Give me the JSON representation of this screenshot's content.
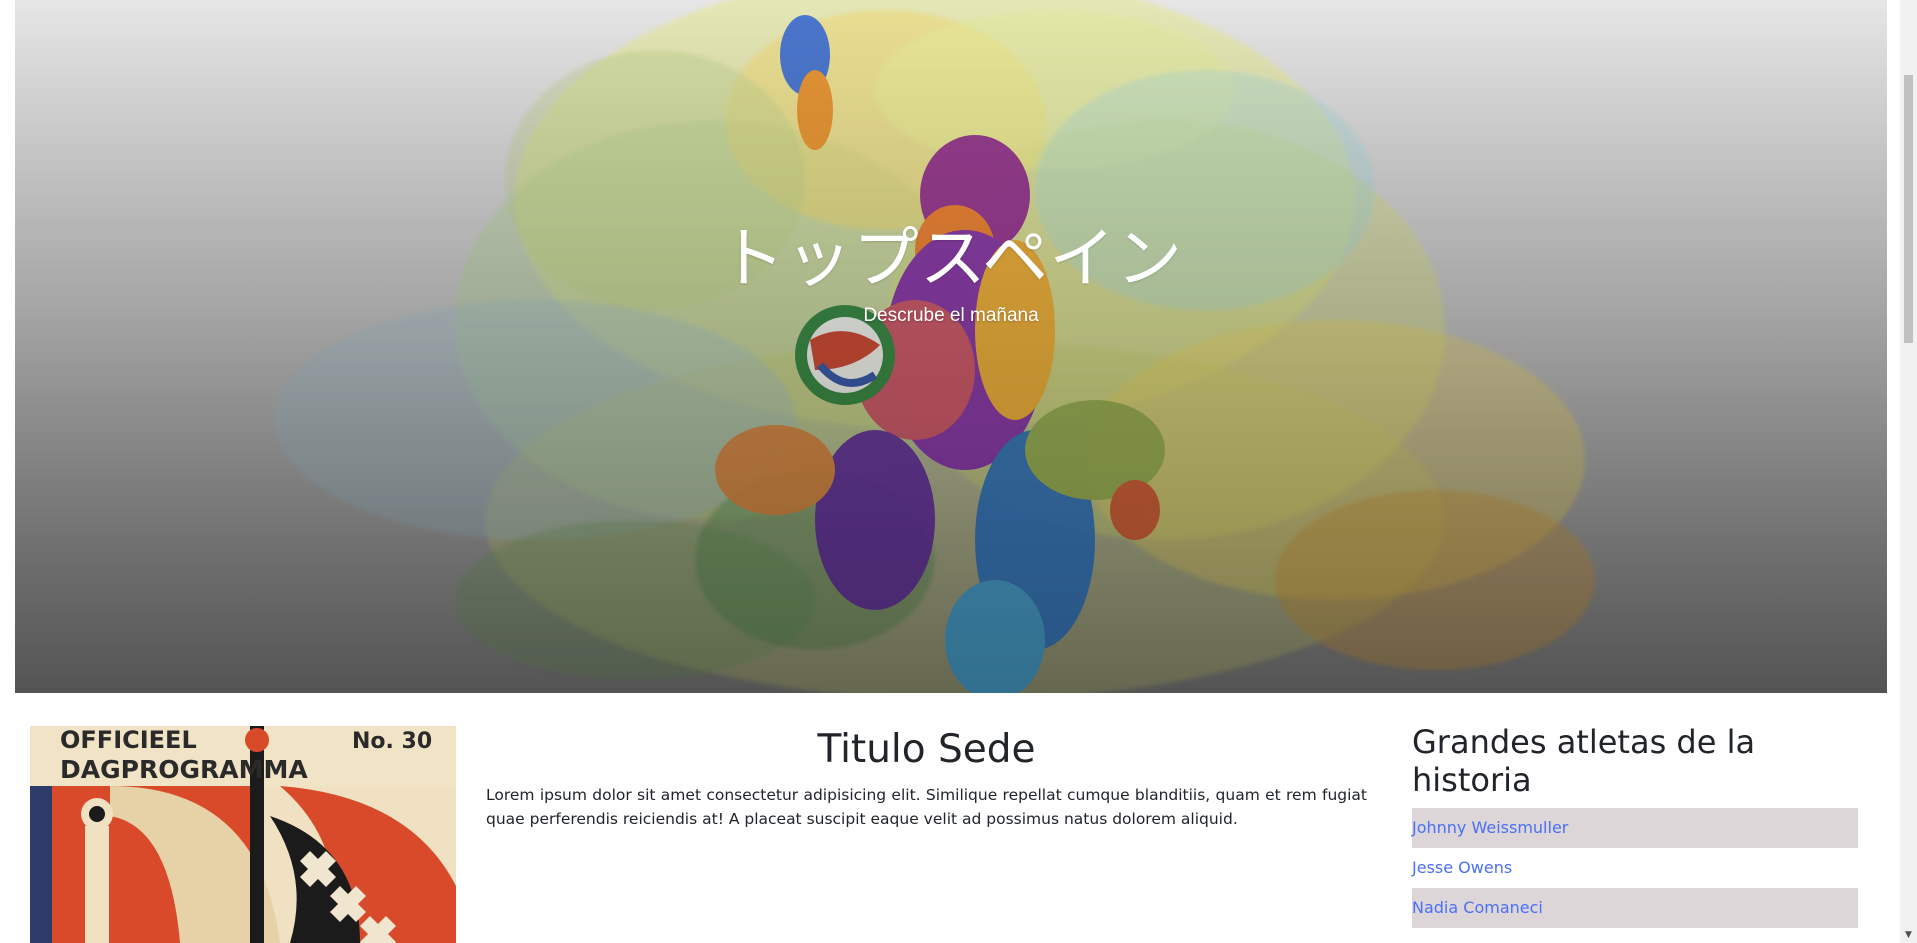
{
  "hero": {
    "title": "トップスペイン",
    "subtitle": "Descrube el mañana",
    "image_icon": "abstract-soccer-player-illustration"
  },
  "poster": {
    "line1": "OFFICIEEL",
    "line2": "DAGPROGRAMMA",
    "number": "No. 30"
  },
  "sede": {
    "title": "Titulo Sede",
    "text": "Lorem ipsum dolor sit amet consectetur adipisicing elit. Similique repellat cumque blanditiis, quam et rem fugiat quae perferendis reiciendis at! A placeat suscipit eaque velit ad possimus natus dolorem aliquid."
  },
  "athletes": {
    "title": "Grandes atletas de la historia",
    "items": [
      {
        "label": "Johnny Weissmuller"
      },
      {
        "label": "Jesse Owens"
      },
      {
        "label": "Nadia Comaneci"
      }
    ]
  },
  "colors": {
    "link": "#4b6ff5",
    "list_shade": "#dcd6d8"
  }
}
